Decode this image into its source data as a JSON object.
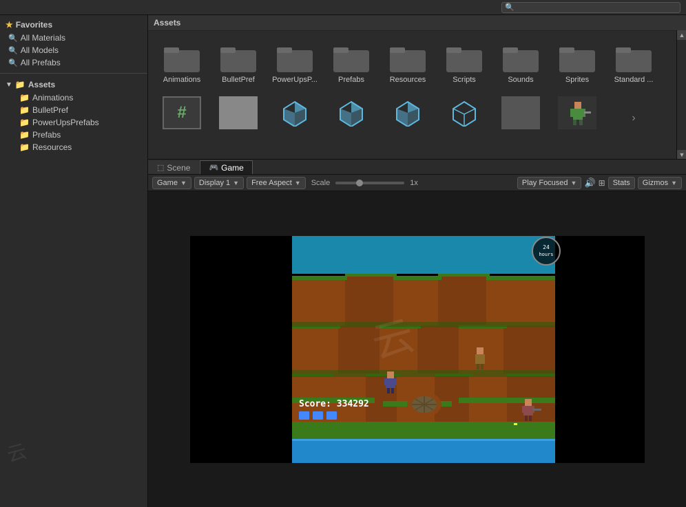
{
  "topbar": {
    "search_placeholder": "🔍"
  },
  "sidebar": {
    "favorites_label": "Favorites",
    "all_materials": "All Materials",
    "all_models": "All Models",
    "all_prefabs": "All Prefabs",
    "assets_label": "Assets",
    "animations": "Animations",
    "bullet_pref": "BulletPref",
    "power_ups_prefabs": "PowerUpsPrefabs",
    "prefabs": "Prefabs",
    "resources": "Resources"
  },
  "assets": {
    "header": "Assets",
    "folders": [
      {
        "label": "Animations"
      },
      {
        "label": "BulletPref"
      },
      {
        "label": "PowerUpsP..."
      },
      {
        "label": "Prefabs"
      },
      {
        "label": "Resources"
      },
      {
        "label": "Scripts"
      },
      {
        "label": "Sounds"
      },
      {
        "label": "Sprites"
      },
      {
        "label": "Standard ..."
      }
    ]
  },
  "tabs": {
    "scene_label": "Scene",
    "game_label": "Game"
  },
  "toolbar": {
    "game_label": "Game",
    "display_label": "Display 1",
    "aspect_label": "Free Aspect",
    "scale_label": "Scale",
    "scale_value": "1x",
    "play_focused_label": "Play Focused",
    "stats_label": "Stats",
    "gizmos_label": "Gizmos"
  },
  "game": {
    "score_label": "Score:",
    "score_value": "334292",
    "timer_label": "24\nhours"
  }
}
